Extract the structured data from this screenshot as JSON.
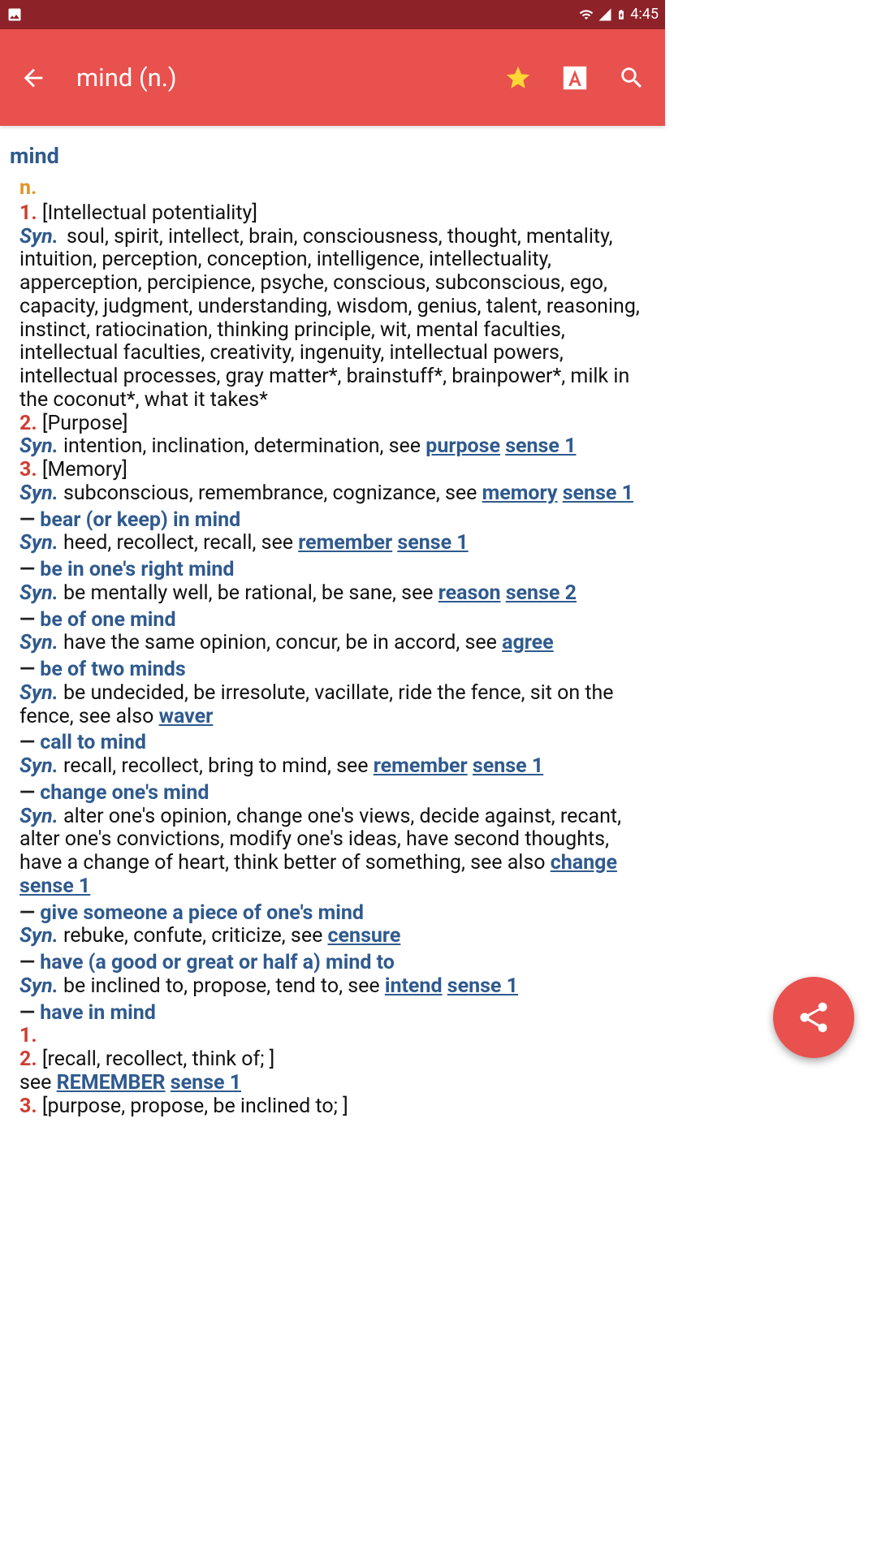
{
  "status": {
    "time": "4:45"
  },
  "appbar": {
    "title": "mind (n.)"
  },
  "entry": {
    "headword": "mind",
    "pos": "n.",
    "senses": [
      {
        "num": "1.",
        "gloss": "[Intellectual potentiality]",
        "syn": "Syn.",
        "text": " soul, spirit, intellect, brain, consciousness, thought, mentality, intuition, perception, conception, intelligence, intellectuality, apperception, percipience, psyche, conscious, subconscious, ego, capacity, judgment, understanding, wisdom, genius, talent, reasoning, instinct, ratiocination, thinking principle, wit, mental faculties, intellectual faculties, creativity, ingenuity, intellectual powers, intellectual processes, gray matter*, brainstuff*, brainpower*, milk in the coconut*, what it takes*"
      },
      {
        "num": "2.",
        "gloss": "[Purpose]",
        "syn": "Syn.",
        "text_before": " intention, inclination, determination, see ",
        "links": [
          [
            "purpose",
            "sense 1"
          ]
        ]
      },
      {
        "num": "3.",
        "gloss": "[Memory]",
        "syn": "Syn.",
        "text_before": " subconscious, remembrance, cognizance, see ",
        "links": [
          [
            "memory",
            "sense 1"
          ]
        ]
      }
    ],
    "idioms": [
      {
        "head": "bear (or keep) in mind",
        "syn": "Syn.",
        "text_before": " heed, recollect, recall, see ",
        "links": [
          [
            "remember",
            "sense 1"
          ]
        ]
      },
      {
        "head": "be in one's right mind",
        "syn": "Syn.",
        "text_before": " be mentally well, be rational, be sane, see ",
        "links": [
          [
            "reason",
            "sense 2"
          ]
        ]
      },
      {
        "head": "be of one mind",
        "syn": "Syn.",
        "text_before": " have the same opinion, concur, be in accord, see ",
        "links": [
          [
            "agree",
            ""
          ]
        ]
      },
      {
        "head": "be of two minds",
        "syn": "Syn.",
        "text_before": " be undecided, be irresolute, vacillate, ride the fence, sit on the fence, see also ",
        "links": [
          [
            "waver",
            ""
          ]
        ]
      },
      {
        "head": "call to mind",
        "syn": "Syn.",
        "text_before": " recall, recollect, bring to mind, see ",
        "links": [
          [
            "remember",
            "sense 1"
          ]
        ]
      },
      {
        "head": "change one's mind",
        "syn": "Syn.",
        "text_before": " alter one's opinion, change one's views, decide against, recant, alter one's convictions, modify one's ideas, have second thoughts, have a change of heart, think better of something, see also ",
        "links": [
          [
            "change",
            "sense 1"
          ]
        ]
      },
      {
        "head": "give someone a piece of one's mind",
        "syn": "Syn.",
        "text_before": " rebuke, confute, criticize, see ",
        "links": [
          [
            "censure",
            ""
          ]
        ]
      },
      {
        "head": "have (a good or great or half a) mind to",
        "syn": "Syn.",
        "text_before": " be inclined to, propose, tend to, see ",
        "links": [
          [
            "intend",
            "sense 1"
          ]
        ]
      }
    ],
    "have_in_mind": {
      "head": "have in mind",
      "r1_num": "1.",
      "r2_num": "2.",
      "r2_gloss": "[recall, recollect, think of; ]",
      "r2_see": "see ",
      "r2_link_word": "REMEMBER",
      "r2_link_sense": "sense 1",
      "r3_num": "3.",
      "r3_gloss": "[purpose, propose, be inclined to; ]"
    }
  }
}
